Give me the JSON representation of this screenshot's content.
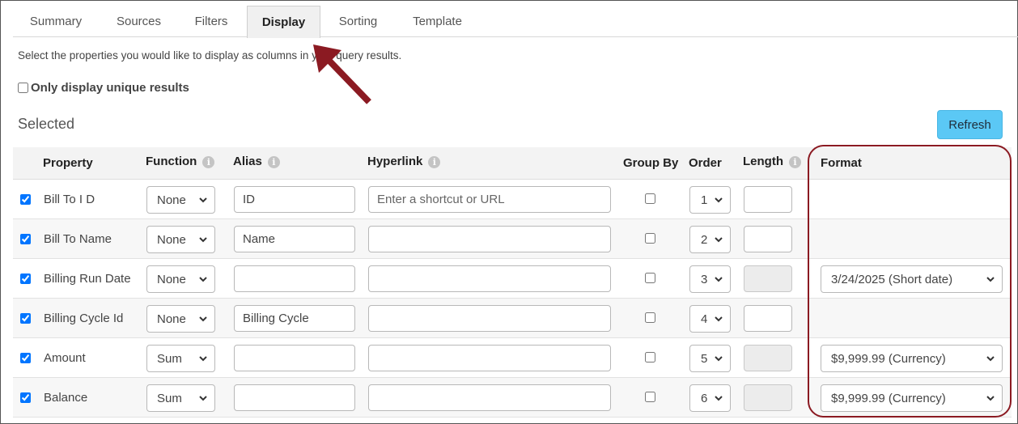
{
  "tabs": [
    {
      "label": "Summary",
      "active": false
    },
    {
      "label": "Sources",
      "active": false
    },
    {
      "label": "Filters",
      "active": false
    },
    {
      "label": "Display",
      "active": true
    },
    {
      "label": "Sorting",
      "active": false
    },
    {
      "label": "Template",
      "active": false
    }
  ],
  "intro": "Select the properties you would like to display as columns in your query results.",
  "unique_label": "Only display unique results",
  "selected_title": "Selected",
  "refresh_label": "Refresh",
  "headers": {
    "property": "Property",
    "function": "Function",
    "alias": "Alias",
    "hyperlink": "Hyperlink",
    "group_by": "Group By",
    "order": "Order",
    "length": "Length",
    "format": "Format"
  },
  "hyperlink_placeholder": "Enter a shortcut or URL",
  "rows": [
    {
      "property": "Bill To I D",
      "function": "None",
      "alias": "ID",
      "order": "1",
      "format": ""
    },
    {
      "property": "Bill To Name",
      "function": "None",
      "alias": "Name",
      "order": "2",
      "format": ""
    },
    {
      "property": "Billing Run Date",
      "function": "None",
      "alias": "",
      "order": "3",
      "format": "3/24/2025 (Short date)"
    },
    {
      "property": "Billing Cycle Id",
      "function": "None",
      "alias": "Billing Cycle",
      "order": "4",
      "format": ""
    },
    {
      "property": "Amount",
      "function": "Sum",
      "alias": "",
      "order": "5",
      "format": "$9,999.99 (Currency)"
    },
    {
      "property": "Balance",
      "function": "Sum",
      "alias": "",
      "order": "6",
      "format": "$9,999.99 (Currency)"
    }
  ],
  "colors": {
    "accent_button": "#5bc8f5",
    "annotation": "#8b1a22"
  }
}
